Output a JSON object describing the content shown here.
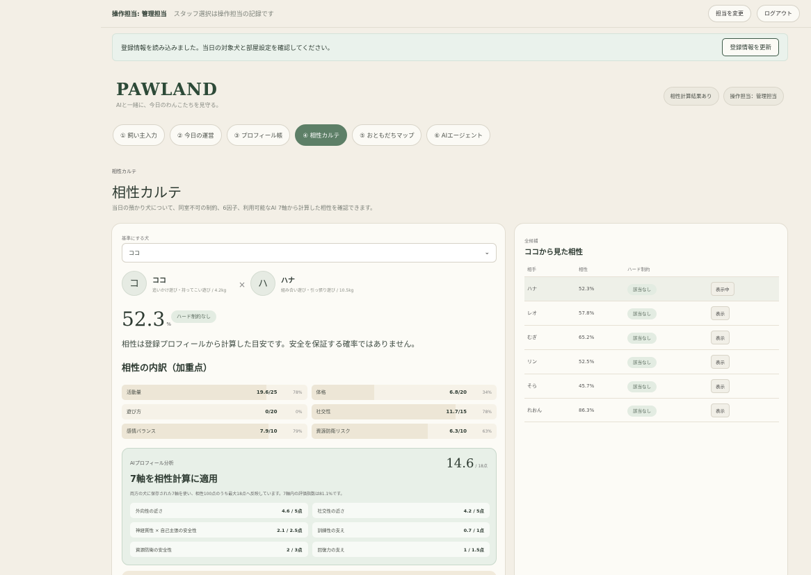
{
  "topbar": {
    "operator": "操作担当: 管理担当",
    "description": "スタッフ選択は操作担当の記録です",
    "change_label": "担当を変更",
    "logout_label": "ログアウト"
  },
  "notice": {
    "message": "登録情報を読み込みました。当日の対象犬と部屋設定を確認してください。",
    "refresh_label": "登録情報を更新"
  },
  "brand": {
    "name": "PAWLAND",
    "tagline": "AIと一緒に、今日のわんこたちを見守る。"
  },
  "header_chips": [
    "相性計算結果あり",
    "操作担当：管理担当"
  ],
  "tabs": [
    {
      "label": "① 飼い主入力"
    },
    {
      "label": "② 今日の運営"
    },
    {
      "label": "③ プロフィール帳"
    },
    {
      "label": "④ 相性カルテ",
      "active": true
    },
    {
      "label": "⑤ おともだちマップ"
    },
    {
      "label": "⑥ AIエージェント"
    }
  ],
  "section": {
    "label": "相性カルテ",
    "title": "相性カルテ",
    "description": "当日の預かり犬について、同室不可の制約、6因子、利用可能なAI 7軸から計算した相性を確認できます。"
  },
  "left": {
    "select_label": "基準にする犬",
    "select_value": "ココ",
    "pet_a": {
      "avatar": "コ",
      "name": "ココ",
      "sub": "追いかけ遊び・持ってこい遊び / 4.2kg"
    },
    "pet_b": {
      "avatar": "ハ",
      "name": "ハナ",
      "sub": "組み合い遊び・引っ張り遊び / 10.5kg"
    },
    "times": "×",
    "score": "52.3",
    "score_unit": "%",
    "hard_chip": "ハード制約なし",
    "note": "相性は登録プロフィールから計算した目安です。安全を保証する確率ではありません。",
    "breakdown_title": "相性の内訳（加重点）",
    "breakdown": [
      {
        "label": "活動量",
        "value": "19.6/25",
        "percent": "78%",
        "ratio": 0.78
      },
      {
        "label": "体格",
        "value": "6.8/20",
        "percent": "34%",
        "ratio": 0.34
      },
      {
        "label": "遊び方",
        "value": "0/20",
        "percent": "0%",
        "ratio": 0
      },
      {
        "label": "社交性",
        "value": "11.7/15",
        "percent": "78%",
        "ratio": 0.78
      },
      {
        "label": "感情バランス",
        "value": "7.9/10",
        "percent": "79%",
        "ratio": 0.79
      },
      {
        "label": "資源防衛リスク",
        "value": "6.3/10",
        "percent": "63%",
        "ratio": 0.63
      }
    ],
    "ai": {
      "kicker": "AIプロフィール分析",
      "title": "7軸を相性計算に適用",
      "score": "14.6",
      "score_unit": "/ 18点",
      "description": "両方の犬に保存された7軸を使い、相性100点のうち最大18点へ反映しています。7軸内の評価指数は81.1%です。",
      "rows": [
        {
          "label": "外向性の近さ",
          "value": "4.6 / 5点"
        },
        {
          "label": "社交性の近さ",
          "value": "4.2 / 5点"
        },
        {
          "label": "神経質性 × 自己主張の安全性",
          "value": "2.1 / 2.5点"
        },
        {
          "label": "訓練性の支え",
          "value": "0.7 / 1点"
        },
        {
          "label": "資源防衛の安全性",
          "value": "2 / 3点"
        },
        {
          "label": "回復力の支え",
          "value": "1 / 1.5点"
        }
      ]
    }
  },
  "right": {
    "kicker": "全候補",
    "title": "ココから見た相性",
    "headers": [
      "相手",
      "相性",
      "ハード制約",
      ""
    ],
    "rows": [
      {
        "name": "ハナ",
        "score": "52.3%",
        "hard": "該当なし",
        "action": "表示中",
        "selected": true
      },
      {
        "name": "レオ",
        "score": "57.8%",
        "hard": "該当なし",
        "action": "表示"
      },
      {
        "name": "むぎ",
        "score": "65.2%",
        "hard": "該当なし",
        "action": "表示"
      },
      {
        "name": "リン",
        "score": "52.5%",
        "hard": "該当なし",
        "action": "表示"
      },
      {
        "name": "そら",
        "score": "45.7%",
        "hard": "該当なし",
        "action": "表示"
      },
      {
        "name": "れおん",
        "score": "86.3%",
        "hard": "該当なし",
        "action": "表示"
      }
    ]
  }
}
